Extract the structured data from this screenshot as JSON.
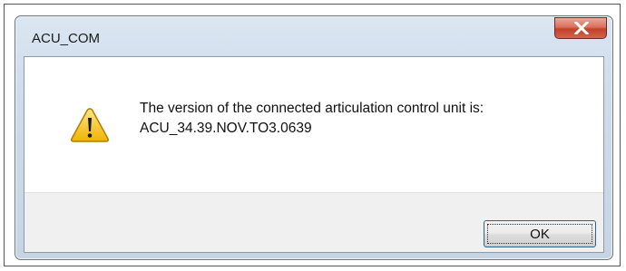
{
  "window": {
    "title": "ACU_COM",
    "close_icon": "close-icon"
  },
  "message": {
    "icon": "warning-icon",
    "line1": "The version of the connected articulation control unit is:",
    "line2": "ACU_34.39.NOV.TO3.0639"
  },
  "buttons": {
    "ok_label": "OK"
  },
  "colors": {
    "close_button": "#c7452d",
    "warning_fill": "#f5c518",
    "dialog_frame": "#cfdcea"
  }
}
